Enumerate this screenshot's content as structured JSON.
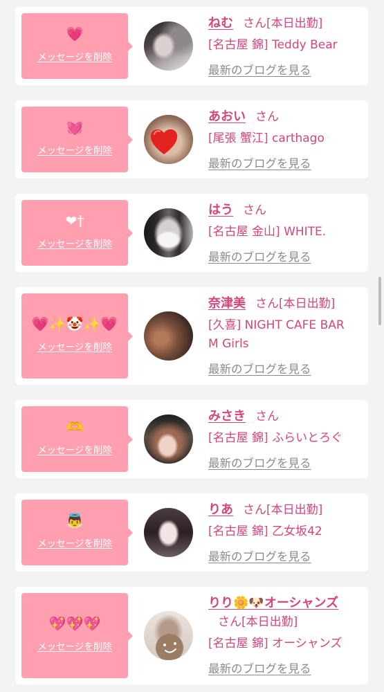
{
  "colors": {
    "page_background": "#f3f3f3",
    "card_background": "#ffffff",
    "message_bubble": "#ff9fb0",
    "message_text": "#ffffff",
    "accent_pink": "#d6457a",
    "blog_link": "#8a8a8a",
    "scrollbar": "#bcbcbc"
  },
  "labels": {
    "delete_message": "メッセージを削除",
    "honorific": "さん",
    "latest_blog": "最新のブログを見る"
  },
  "cards": [
    {
      "message": "💗",
      "name": "ねむ",
      "status": "[本日出勤]",
      "shop": "[名古屋 錦] Teddy Bear"
    },
    {
      "message": "💓",
      "name": "あおい",
      "shop": "[尾張 蟹江] carthago"
    },
    {
      "message": "❤︎†",
      "name": "はう",
      "shop": "[名古屋 金山] WHITE."
    },
    {
      "message": "💗✨🤡✨💗",
      "name": "奈津美",
      "status": "[本日出勤]",
      "shop": "[久喜] NIGHT CAFE BAR M Girls"
    },
    {
      "message": "🫶",
      "name": "みさき",
      "shop": "[名古屋 錦] ふらいとろぐ"
    },
    {
      "message": "👼",
      "name": "りあ",
      "status": "[本日出勤]",
      "shop": "[名古屋 錦] 乙女坂42"
    },
    {
      "message": "💖💖💖",
      "name": "りり🌼🐶オーシャンズ",
      "status": "[本日出勤]",
      "shop": "[名古屋 錦] オーシャンズ"
    }
  ]
}
